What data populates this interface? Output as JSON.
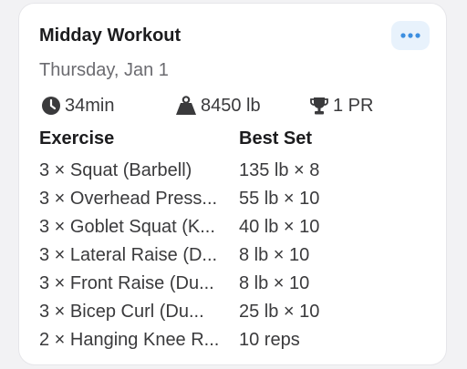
{
  "card": {
    "title": "Midday Workout",
    "date": "Thursday, Jan 1",
    "more_button": {
      "icon": "more-horizontal-icon",
      "color": "#3d8fe0"
    }
  },
  "stats": {
    "duration": {
      "icon": "clock-icon",
      "value": "34min"
    },
    "volume": {
      "icon": "weight-icon",
      "value": "8450 lb"
    },
    "pr": {
      "icon": "trophy-icon",
      "value": "1 PR"
    }
  },
  "table": {
    "headers": {
      "exercise": "Exercise",
      "best_set": "Best Set"
    },
    "rows": [
      {
        "exercise": "3 × Squat (Barbell)",
        "best_set": "135 lb × 8"
      },
      {
        "exercise": "3 × Overhead Press...",
        "best_set": "55 lb × 10"
      },
      {
        "exercise": "3 × Goblet Squat (K...",
        "best_set": "40 lb × 10"
      },
      {
        "exercise": "3 × Lateral Raise (D...",
        "best_set": "8 lb × 10"
      },
      {
        "exercise": "3 × Front Raise (Du...",
        "best_set": "8 lb × 10"
      },
      {
        "exercise": "3 × Bicep Curl (Du...",
        "best_set": "25 lb × 10"
      },
      {
        "exercise": "2 × Hanging Knee R...",
        "best_set": "10 reps"
      }
    ]
  }
}
